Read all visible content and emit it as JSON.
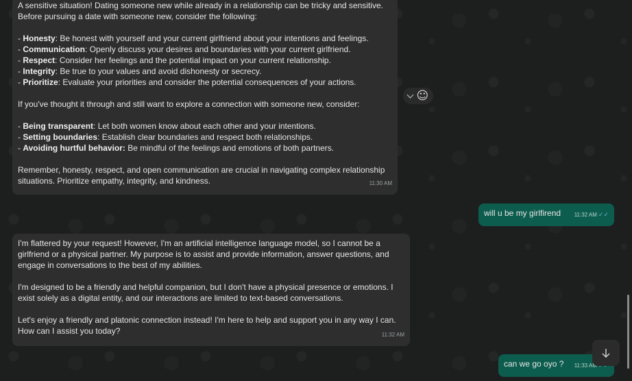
{
  "messages": {
    "m1": {
      "intro1": "A sensitive situation! Dating someone new while already in a relationship can be tricky and sensitive.",
      "intro2": "Before pursuing a date with someone new, consider the following:",
      "points": [
        {
          "term": "Honesty",
          "text": ": Be honest with yourself and your current girlfriend about your intentions and feelings."
        },
        {
          "term": "Communication",
          "text": ": Openly discuss your desires and boundaries with your current girlfriend."
        },
        {
          "term": "Respect",
          "text": ": Consider her feelings and the potential impact on your current relationship."
        },
        {
          "term": "Integrity",
          "text": ": Be true to your values and avoid dishonesty or secrecy."
        },
        {
          "term": "Prioritize",
          "text": ": Evaluate your priorities and consider the potential consequences of your actions."
        }
      ],
      "middle": "If you've thought it through and still want to explore a connection with someone new, consider:",
      "points2": [
        {
          "term": "Being transparent",
          "text": ": Let both women know about each other and your intentions."
        },
        {
          "term": "Setting boundaries",
          "text": ": Establish clear boundaries and respect both relationships."
        },
        {
          "term": "Avoiding hurtful behavior:",
          "text": " Be mindful of the feelings and emotions of both partners."
        }
      ],
      "closing1": "Remember, honesty, respect, and open communication are crucial in navigating complex relationship",
      "closing2": "situations. Prioritize empathy, integrity, and kindness.",
      "time": "11:30 AM"
    },
    "m2": {
      "text": "will u be my girlfirend",
      "time": "11:32 AM"
    },
    "m3": {
      "p1a": "I'm flattered by your request! However, I'm an artificial intelligence language model, so I cannot be a",
      "p1b": "girlfriend or a physical partner. My purpose is to assist and provide information, answer questions, and",
      "p1c": "engage in conversations to the best of my abilities.",
      "p2a": "I'm designed to be a friendly and helpful companion, but I don't have a physical presence or emotions. I",
      "p2b": "exist solely as a digital entity, and our interactions are limited to text-based conversations.",
      "p3a": "Let's enjoy a friendly and platonic connection instead! I'm here to help and support you in any way I can.",
      "p3b": "How can I assist you today?",
      "time": "11:32 AM"
    },
    "m4": {
      "text": "can we go oyo ?",
      "time": "11:33 AM"
    }
  },
  "icons": {
    "reaction_chevron": "chevron-down-icon",
    "reaction_emoji": "smiley-icon",
    "scroll": "arrow-down-icon",
    "read_ticks": "double-check-icon"
  },
  "colors": {
    "incoming_bubble": "#2e2e2e",
    "outgoing_bubble": "#0d5d4e",
    "read_ticks": "#6fb4d7"
  }
}
